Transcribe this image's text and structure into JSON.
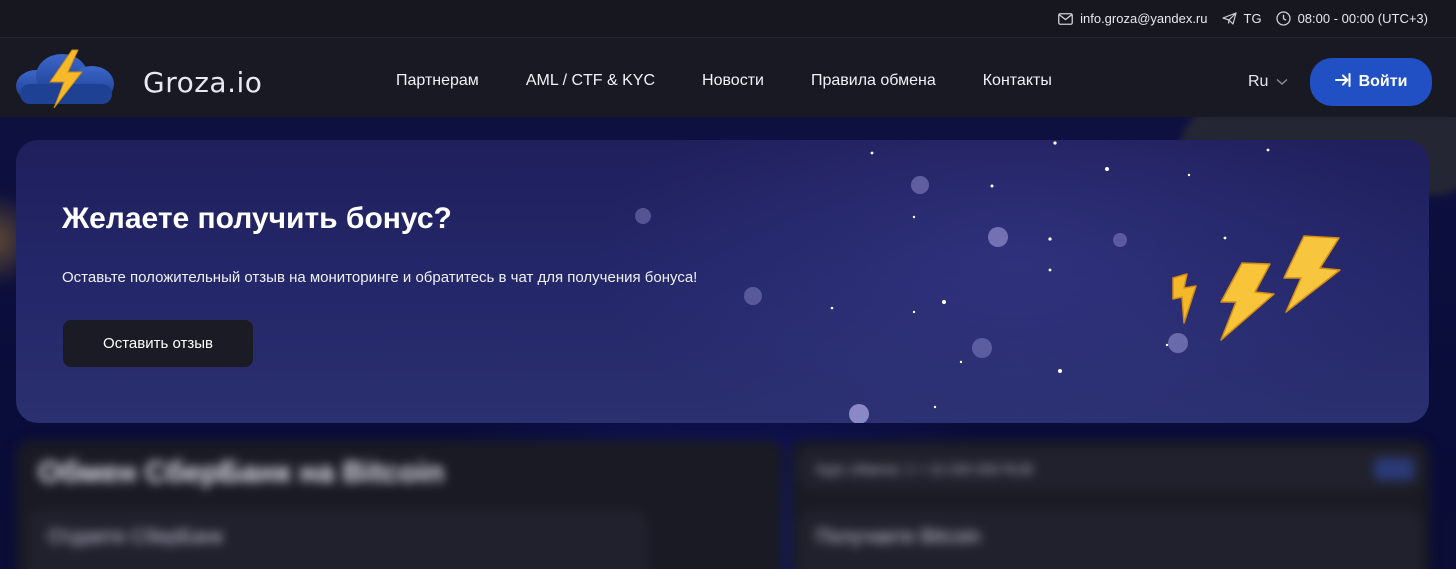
{
  "topbar": {
    "email": "info.groza@yandex.ru",
    "telegram": "TG",
    "hours": "08:00 - 00:00 (UTC+3)",
    "icons": [
      "mail-icon",
      "telegram-icon",
      "clock-icon"
    ]
  },
  "header": {
    "brand": "Groza.io",
    "nav": [
      "Партнерам",
      "AML / CTF & KYC",
      "Новости",
      "Правила обмена",
      "Контакты"
    ],
    "language": "Ru",
    "login_label": "Войти"
  },
  "banner": {
    "title": "Желаете получить бонус?",
    "text": "Оставьте положительный отзыв на мониторинге и обратитесь в чат для получения бонуса!",
    "button_label": "Оставить отзыв"
  },
  "lower": {
    "exchange_title": "Обмен СберБанк на Bitcoin",
    "give_label": "Отдаете СберБанк",
    "rate_label": "Курс обмена: 1 = 10 200 000 RUB",
    "get_label": "Получаете Bitcoin"
  },
  "colors": {
    "accent_button": "#2150c4",
    "banner_bg": "#232668",
    "header_bg": "#181922",
    "bolt_yellow": "#f6b92a"
  }
}
